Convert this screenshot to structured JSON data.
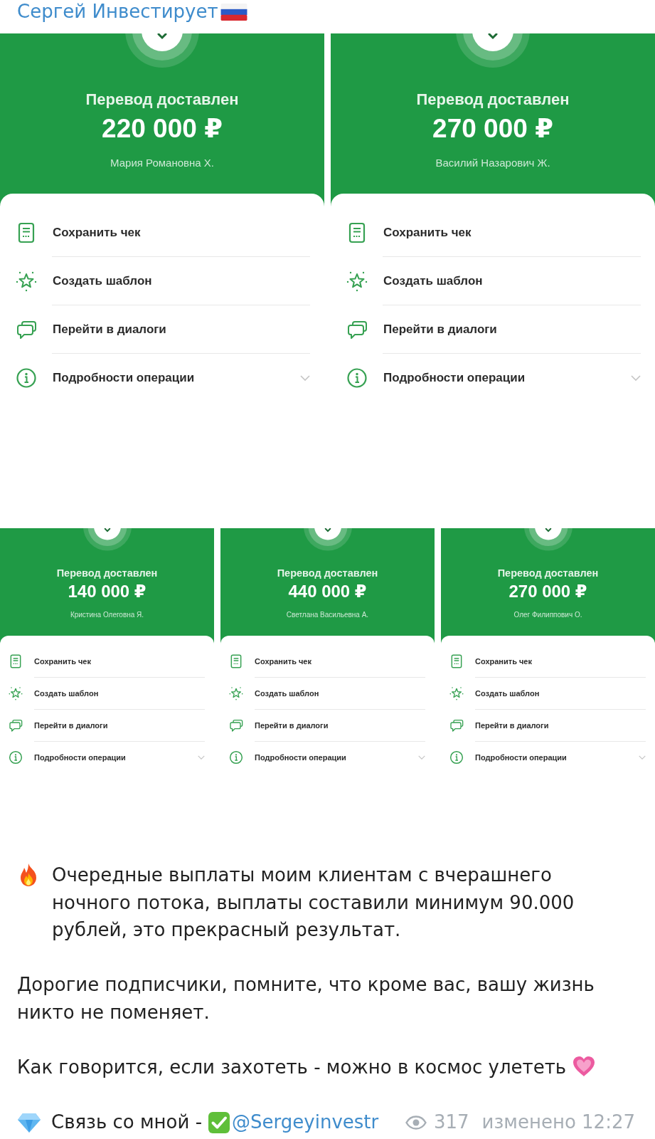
{
  "channel": {
    "name": "Сергей Инвестирует"
  },
  "collage": [
    {
      "kind": "large",
      "receipts": [
        {
          "status": "Перевод доставлен",
          "amount": "220 000 ₽",
          "recipient": "Мария Романовна Х.",
          "actions": [
            {
              "kind": "receipt",
              "label": "Сохранить чек"
            },
            {
              "kind": "template",
              "label": "Создать шаблон"
            },
            {
              "kind": "dialogs",
              "label": "Перейти в диалоги"
            },
            {
              "kind": "details",
              "label": "Подробности операции"
            }
          ]
        },
        {
          "status": "Перевод доставлен",
          "amount": "270 000 ₽",
          "recipient": "Василий Назарович Ж.",
          "actions": [
            {
              "kind": "receipt",
              "label": "Сохранить чек"
            },
            {
              "kind": "template",
              "label": "Создать шаблон"
            },
            {
              "kind": "dialogs",
              "label": "Перейти в диалоги"
            },
            {
              "kind": "details",
              "label": "Подробности операции"
            }
          ]
        }
      ]
    },
    {
      "kind": "small",
      "receipts": [
        {
          "status": "Перевод доставлен",
          "amount": "140 000 ₽",
          "recipient": "Кристина Олеговна Я.",
          "actions": [
            {
              "kind": "receipt",
              "label": "Сохранить чек"
            },
            {
              "kind": "template",
              "label": "Создать шаблон"
            },
            {
              "kind": "dialogs",
              "label": "Перейти в диалоги"
            },
            {
              "kind": "details",
              "label": "Подробности операции"
            }
          ]
        },
        {
          "status": "Перевод доставлен",
          "amount": "440 000 ₽",
          "recipient": "Светлана Васильевна А.",
          "actions": [
            {
              "kind": "receipt",
              "label": "Сохранить чек"
            },
            {
              "kind": "template",
              "label": "Создать шаблон"
            },
            {
              "kind": "dialogs",
              "label": "Перейти в диалоги"
            },
            {
              "kind": "details",
              "label": "Подробности операции"
            }
          ]
        },
        {
          "status": "Перевод доставлен",
          "amount": "270 000 ₽",
          "recipient": "Олег Филиппович О.",
          "actions": [
            {
              "kind": "receipt",
              "label": "Сохранить чек"
            },
            {
              "kind": "template",
              "label": "Создать шаблон"
            },
            {
              "kind": "dialogs",
              "label": "Перейти в диалоги"
            },
            {
              "kind": "details",
              "label": "Подробности операции"
            }
          ]
        }
      ]
    }
  ],
  "post": {
    "intro": "Очередные выплаты моим клиентам с вчерашнего ночного потока, выплаты составили минимум 90.000 рублей, это прекрасный результат.",
    "body": "Дорогие подписчики, помните, что кроме вас, вашу жизнь никто не поменяет.",
    "closing": "Как говорится, если захотеть - можно в космос улететь",
    "contact": {
      "label": "Связь со мной -",
      "link": "@Sergeyinvestr"
    },
    "views": "317",
    "edited": "изменено 12:27"
  }
}
